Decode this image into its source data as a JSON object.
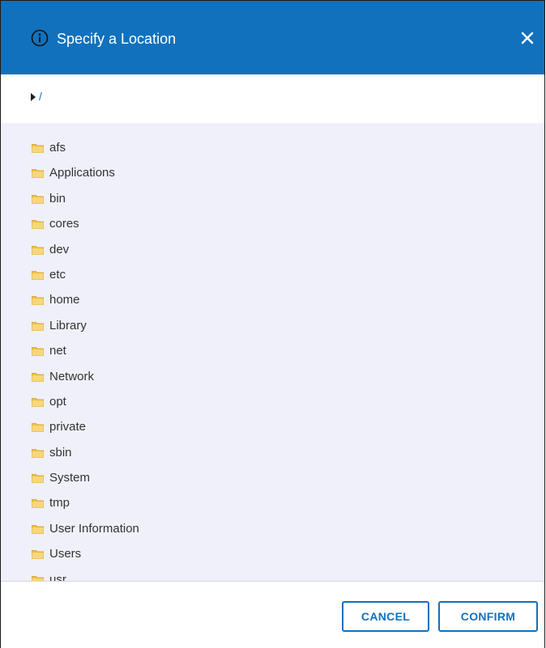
{
  "dialog": {
    "title": "Specify a Location",
    "header_color": "#1271bc",
    "info_icon": "info-circle-icon",
    "close_icon": "close-icon"
  },
  "path": {
    "text": "/",
    "caret_icon": "caret-right-icon"
  },
  "folders": [
    {
      "label": "afs"
    },
    {
      "label": "Applications"
    },
    {
      "label": "bin"
    },
    {
      "label": "cores"
    },
    {
      "label": "dev"
    },
    {
      "label": "etc"
    },
    {
      "label": "home"
    },
    {
      "label": "Library"
    },
    {
      "label": "net"
    },
    {
      "label": "Network"
    },
    {
      "label": "opt"
    },
    {
      "label": "private"
    },
    {
      "label": "sbin"
    },
    {
      "label": "System"
    },
    {
      "label": "tmp"
    },
    {
      "label": "User Information"
    },
    {
      "label": "Users"
    },
    {
      "label": "usr"
    }
  ],
  "buttons": {
    "cancel": "CANCEL",
    "confirm": "CONFIRM"
  }
}
